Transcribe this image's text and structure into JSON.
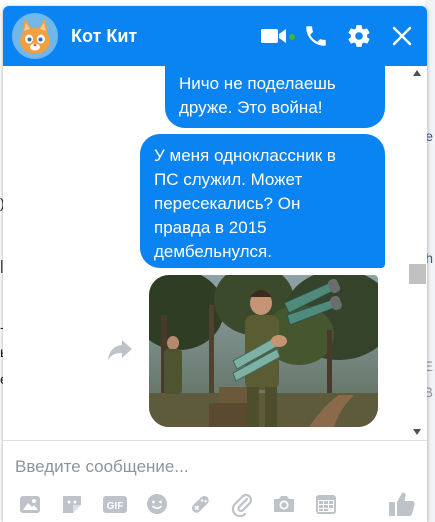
{
  "chat": {
    "title": "Кот Кит",
    "online": true,
    "messages": [
      {
        "text": "Ничо не поделаешь\nдруже. Это война!"
      },
      {
        "text": "У меня одноклассник в\nПС служил. Может\nпересекались? Он\nправда в 2015\nдембельнулся."
      }
    ],
    "photo_alt": "photo-attachment"
  },
  "composer": {
    "placeholder": "Введите сообщение..."
  },
  "icons": {
    "header": [
      "video-camera-icon",
      "phone-icon",
      "gear-icon",
      "close-icon"
    ],
    "toolbar": [
      "photo-icon",
      "sticker-icon",
      "gif-icon",
      "emoji-icon",
      "games-icon",
      "paperclip-icon",
      "camera-icon",
      "calendar-icon",
      "like-icon"
    ]
  },
  "colors": {
    "brand": "#0a84f2",
    "online": "#42b72a",
    "toolbar_icon": "#bec3c9"
  }
}
